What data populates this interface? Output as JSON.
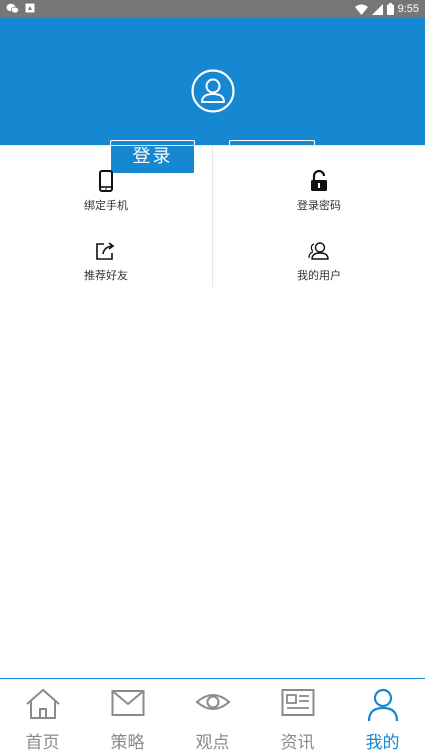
{
  "status_bar": {
    "time": "9:55",
    "icons": [
      "wechat-icon",
      "notification-icon",
      "wifi-icon",
      "signal-icon",
      "battery-icon"
    ]
  },
  "profile": {
    "avatar_icon": "user-circle-icon",
    "login_label": "登录"
  },
  "menu": {
    "items": [
      {
        "label": "绑定手机",
        "icon": "phone-icon"
      },
      {
        "label": "登录密码",
        "icon": "lock-icon"
      },
      {
        "label": "推荐好友",
        "icon": "share-icon"
      },
      {
        "label": "我的用户",
        "icon": "users-icon"
      }
    ]
  },
  "tabbar": {
    "tabs": [
      {
        "label": "首页",
        "icon": "home-icon",
        "active": false
      },
      {
        "label": "策略",
        "icon": "mail-icon",
        "active": false
      },
      {
        "label": "观点",
        "icon": "eye-icon",
        "active": false
      },
      {
        "label": "资讯",
        "icon": "news-icon",
        "active": false
      },
      {
        "label": "我的",
        "icon": "user-icon",
        "active": true
      }
    ]
  },
  "colors": {
    "accent": "#1688d2",
    "inactive": "#8a8a8a",
    "status_bar": "#767676"
  }
}
